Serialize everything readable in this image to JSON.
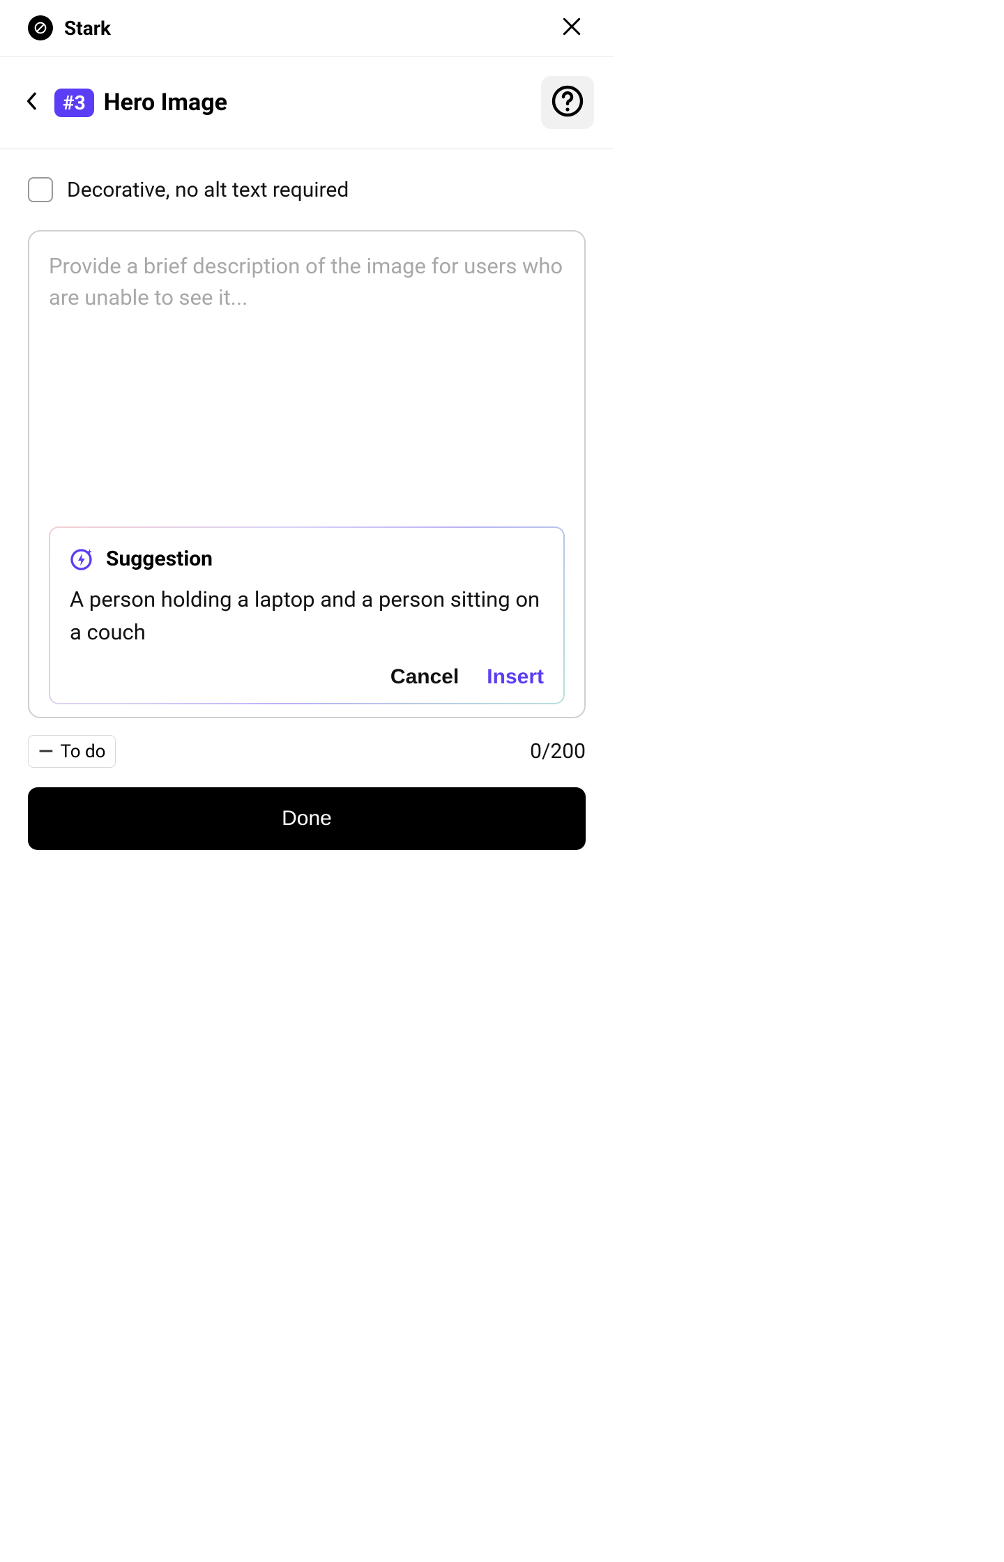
{
  "header": {
    "brand": "Stark"
  },
  "titlebar": {
    "badge": "#3",
    "title": "Hero Image"
  },
  "body": {
    "decorative_label": "Decorative, no alt text required",
    "textarea_placeholder": "Provide a brief description of the image for users who are unable to see it...",
    "textarea_value": ""
  },
  "suggestion": {
    "title": "Suggestion",
    "text": "A person holding a laptop and a person sitting on a couch",
    "cancel_label": "Cancel",
    "insert_label": "Insert"
  },
  "meta": {
    "todo_label": "To do",
    "counter": "0/200"
  },
  "footer": {
    "done_label": "Done"
  }
}
